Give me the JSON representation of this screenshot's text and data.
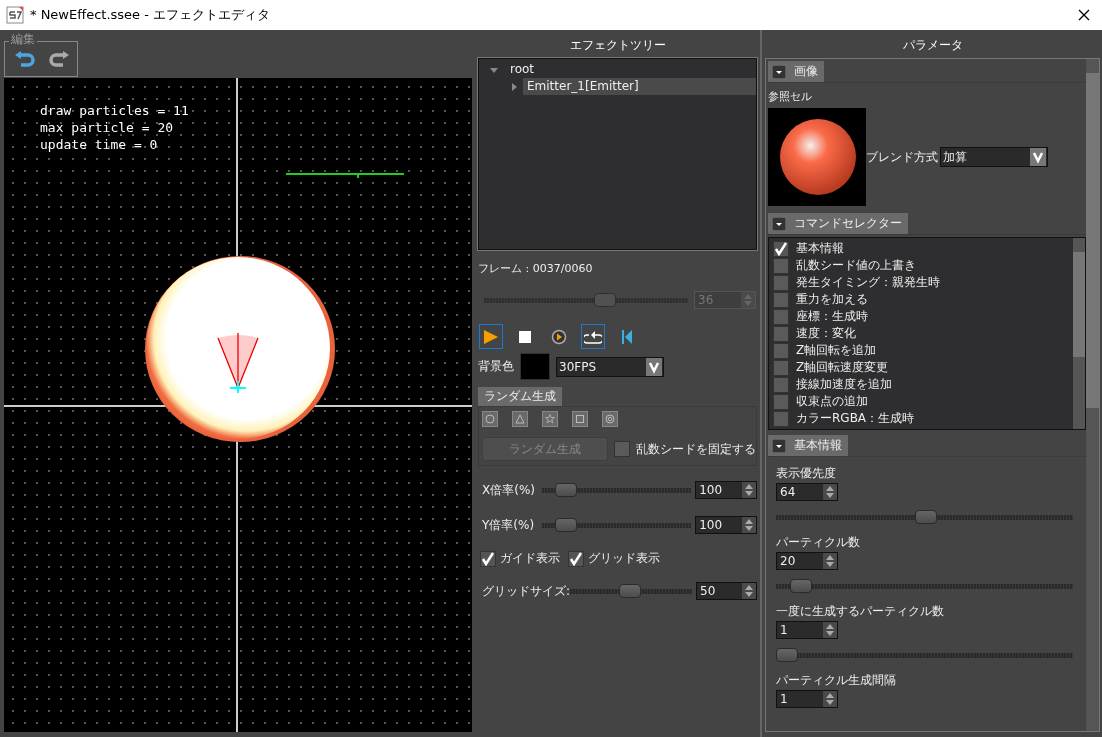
{
  "window": {
    "title": "* NewEffect.ssee - エフェクトエディタ"
  },
  "edit_group": {
    "label": "編集"
  },
  "viewport": {
    "stats": [
      "draw particles = 11",
      "max particle = 20",
      "update time = 0"
    ]
  },
  "effect_tree": {
    "title": "エフェクトツリー",
    "nodes": [
      {
        "label": "root",
        "expanded": true,
        "selected": false,
        "children": [
          {
            "label": "Emitter_1[Emitter]",
            "expanded": false,
            "selected": true
          }
        ]
      }
    ]
  },
  "playback": {
    "frame_label": "フレーム : 0037/0060",
    "level": 0.58,
    "frame_value": "36",
    "buttons": [
      {
        "kind": "play",
        "selected": true
      },
      {
        "kind": "stop",
        "selected": false
      },
      {
        "kind": "step",
        "selected": false
      },
      {
        "kind": "loop",
        "selected": true
      },
      {
        "kind": "rewind",
        "selected": false
      }
    ]
  },
  "background": {
    "label": "背景色",
    "fps": "30FPS"
  },
  "random_gen": {
    "tab": "ランダム生成",
    "shapes": [
      {
        "kind": "circle"
      },
      {
        "kind": "triangle"
      },
      {
        "kind": "star"
      },
      {
        "kind": "square"
      },
      {
        "kind": "ring"
      }
    ],
    "button": "ランダム生成",
    "fix_seed": {
      "label": "乱数シードを固定する",
      "checked": false
    },
    "scales": [
      {
        "label": "X倍率(%)",
        "level": 0.1,
        "value": "100"
      },
      {
        "label": "Y倍率(%)",
        "level": 0.1,
        "value": "100"
      }
    ]
  },
  "display": {
    "checks": [
      {
        "label": "ガイド表示",
        "checked": true
      },
      {
        "label": "グリッド表示",
        "checked": true
      }
    ],
    "grid_size": {
      "label": "グリッドサイズ:",
      "level": 0.48,
      "value": "50"
    }
  },
  "parameters": {
    "title": "パラメータ",
    "image_section": {
      "title": "画像",
      "expanded": true,
      "cell_label": "参照セル",
      "blend_label": "ブレンド方式",
      "blend_value": "加算"
    },
    "command_section": {
      "title": "コマンドセレクター",
      "expanded": true,
      "commands": [
        {
          "label": "基本情報",
          "checked": true
        },
        {
          "label": "乱数シード値の上書き",
          "checked": false
        },
        {
          "label": "発生タイミング：親発生時",
          "checked": false
        },
        {
          "label": "重力を加える",
          "checked": false
        },
        {
          "label": "座標：生成時",
          "checked": false
        },
        {
          "label": "速度：変化",
          "checked": false
        },
        {
          "label": "Z軸回転を追加",
          "checked": false
        },
        {
          "label": "Z軸回転速度変更",
          "checked": false
        },
        {
          "label": "接線加速度を追加",
          "checked": false
        },
        {
          "label": "収束点の追加",
          "checked": false
        },
        {
          "label": "カラーRGBA：生成時",
          "checked": false
        }
      ]
    },
    "basic_section": {
      "title": "基本情報",
      "expanded": true,
      "fields": [
        {
          "label": "表示優先度",
          "value": "64",
          "level": 0.5
        },
        {
          "label": "パーティクル数",
          "value": "20",
          "level": 0.05
        },
        {
          "label": "一度に生成するパーティクル数",
          "value": "1",
          "level": 0.0
        },
        {
          "label": "パーティクル生成間隔",
          "value": "1"
        }
      ]
    }
  }
}
